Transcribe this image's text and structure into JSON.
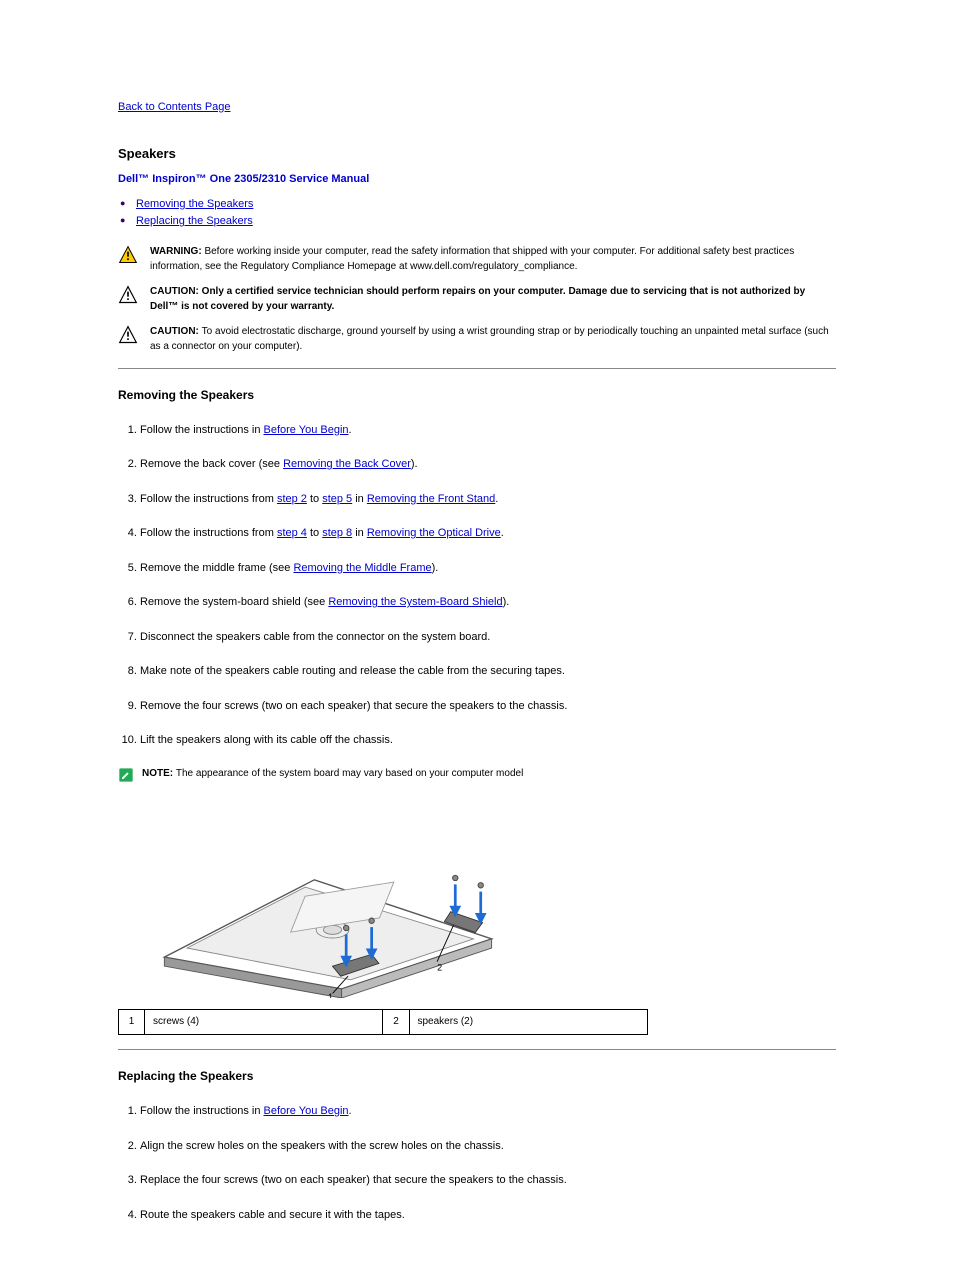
{
  "nav": {
    "back": "Back to Contents Page"
  },
  "header": {
    "section": "Speakers",
    "manual": "Dell™ Inspiron™ One 2305/2310 Service Manual"
  },
  "toc": {
    "item1": "Removing the Speakers",
    "item2": "Replacing the Speakers"
  },
  "notices": {
    "warning_lead": "WARNING: ",
    "warning_body": "Before working inside your computer, read the safety information that shipped with your computer. For additional safety best practices information, see the Regulatory Compliance Homepage at www.dell.com/regulatory_compliance.",
    "caution1_lead": "CAUTION: ",
    "caution1_body": "Only a certified service technician should perform repairs on your computer. Damage due to servicing that is not authorized by Dell™ is not covered by your warranty.",
    "caution2_lead": "CAUTION: ",
    "caution2_body": "To avoid electrostatic discharge, ground yourself by using a wrist grounding strap or by periodically touching an unpainted metal surface (such as a connector on your computer)."
  },
  "remove": {
    "title": "Removing the Speakers",
    "steps": {
      "s1a": "Follow the instructions in ",
      "s1l": "Before You Begin",
      "s1b": ".",
      "s2a": "Remove the back cover (see ",
      "s2l": "Removing the Back Cover",
      "s2b": ").",
      "s3a": "Follow the instructions from ",
      "s3l1": "step 2",
      "s3m": " to ",
      "s3l2": "step 5",
      "s3n": " in ",
      "s3l3": "Removing the Front Stand",
      "s3b": ".",
      "s4a": "Follow the instructions from ",
      "s4l1": "step 4",
      "s4m": " to ",
      "s4l2": "step 8",
      "s4n": " in ",
      "s4l3": "Removing the Optical Drive",
      "s4b": ".",
      "s5a": "Remove the middle frame (see ",
      "s5l": "Removing the Middle Frame",
      "s5b": ").",
      "s6a": "Remove the system-board shield (see ",
      "s6l": "Removing the System-Board Shield",
      "s6b": ").",
      "s7": "Disconnect the speakers cable from the connector on the system board.",
      "s8": "Make note of the speakers cable routing and release the cable from the securing tapes.",
      "s9": "Remove the four screws (two on each speaker) that secure the speakers to the chassis.",
      "s10": "Lift the speakers along with its cable off the chassis."
    },
    "note_lead": "NOTE: ",
    "note_body": "The appearance of the system board may vary based on your computer model"
  },
  "legend": {
    "c1n": "1",
    "c1t": "screws (4)",
    "c2n": "2",
    "c2t": "speakers (2)"
  },
  "replace": {
    "title": "Replacing the Speakers",
    "steps": {
      "s1a": "Follow the instructions in ",
      "s1l": "Before You Begin",
      "s1b": ".",
      "s2": "Align the screw holes on the speakers with the screw holes on the chassis.",
      "s3": "Replace the four screws (two on each speaker) that secure the speakers to the chassis.",
      "s4": "Route the speakers cable and secure it with the tapes."
    }
  },
  "icons": {
    "warning": "warning-triangle-icon",
    "caution": "caution-triangle-icon",
    "note": "note-pencil-icon"
  }
}
